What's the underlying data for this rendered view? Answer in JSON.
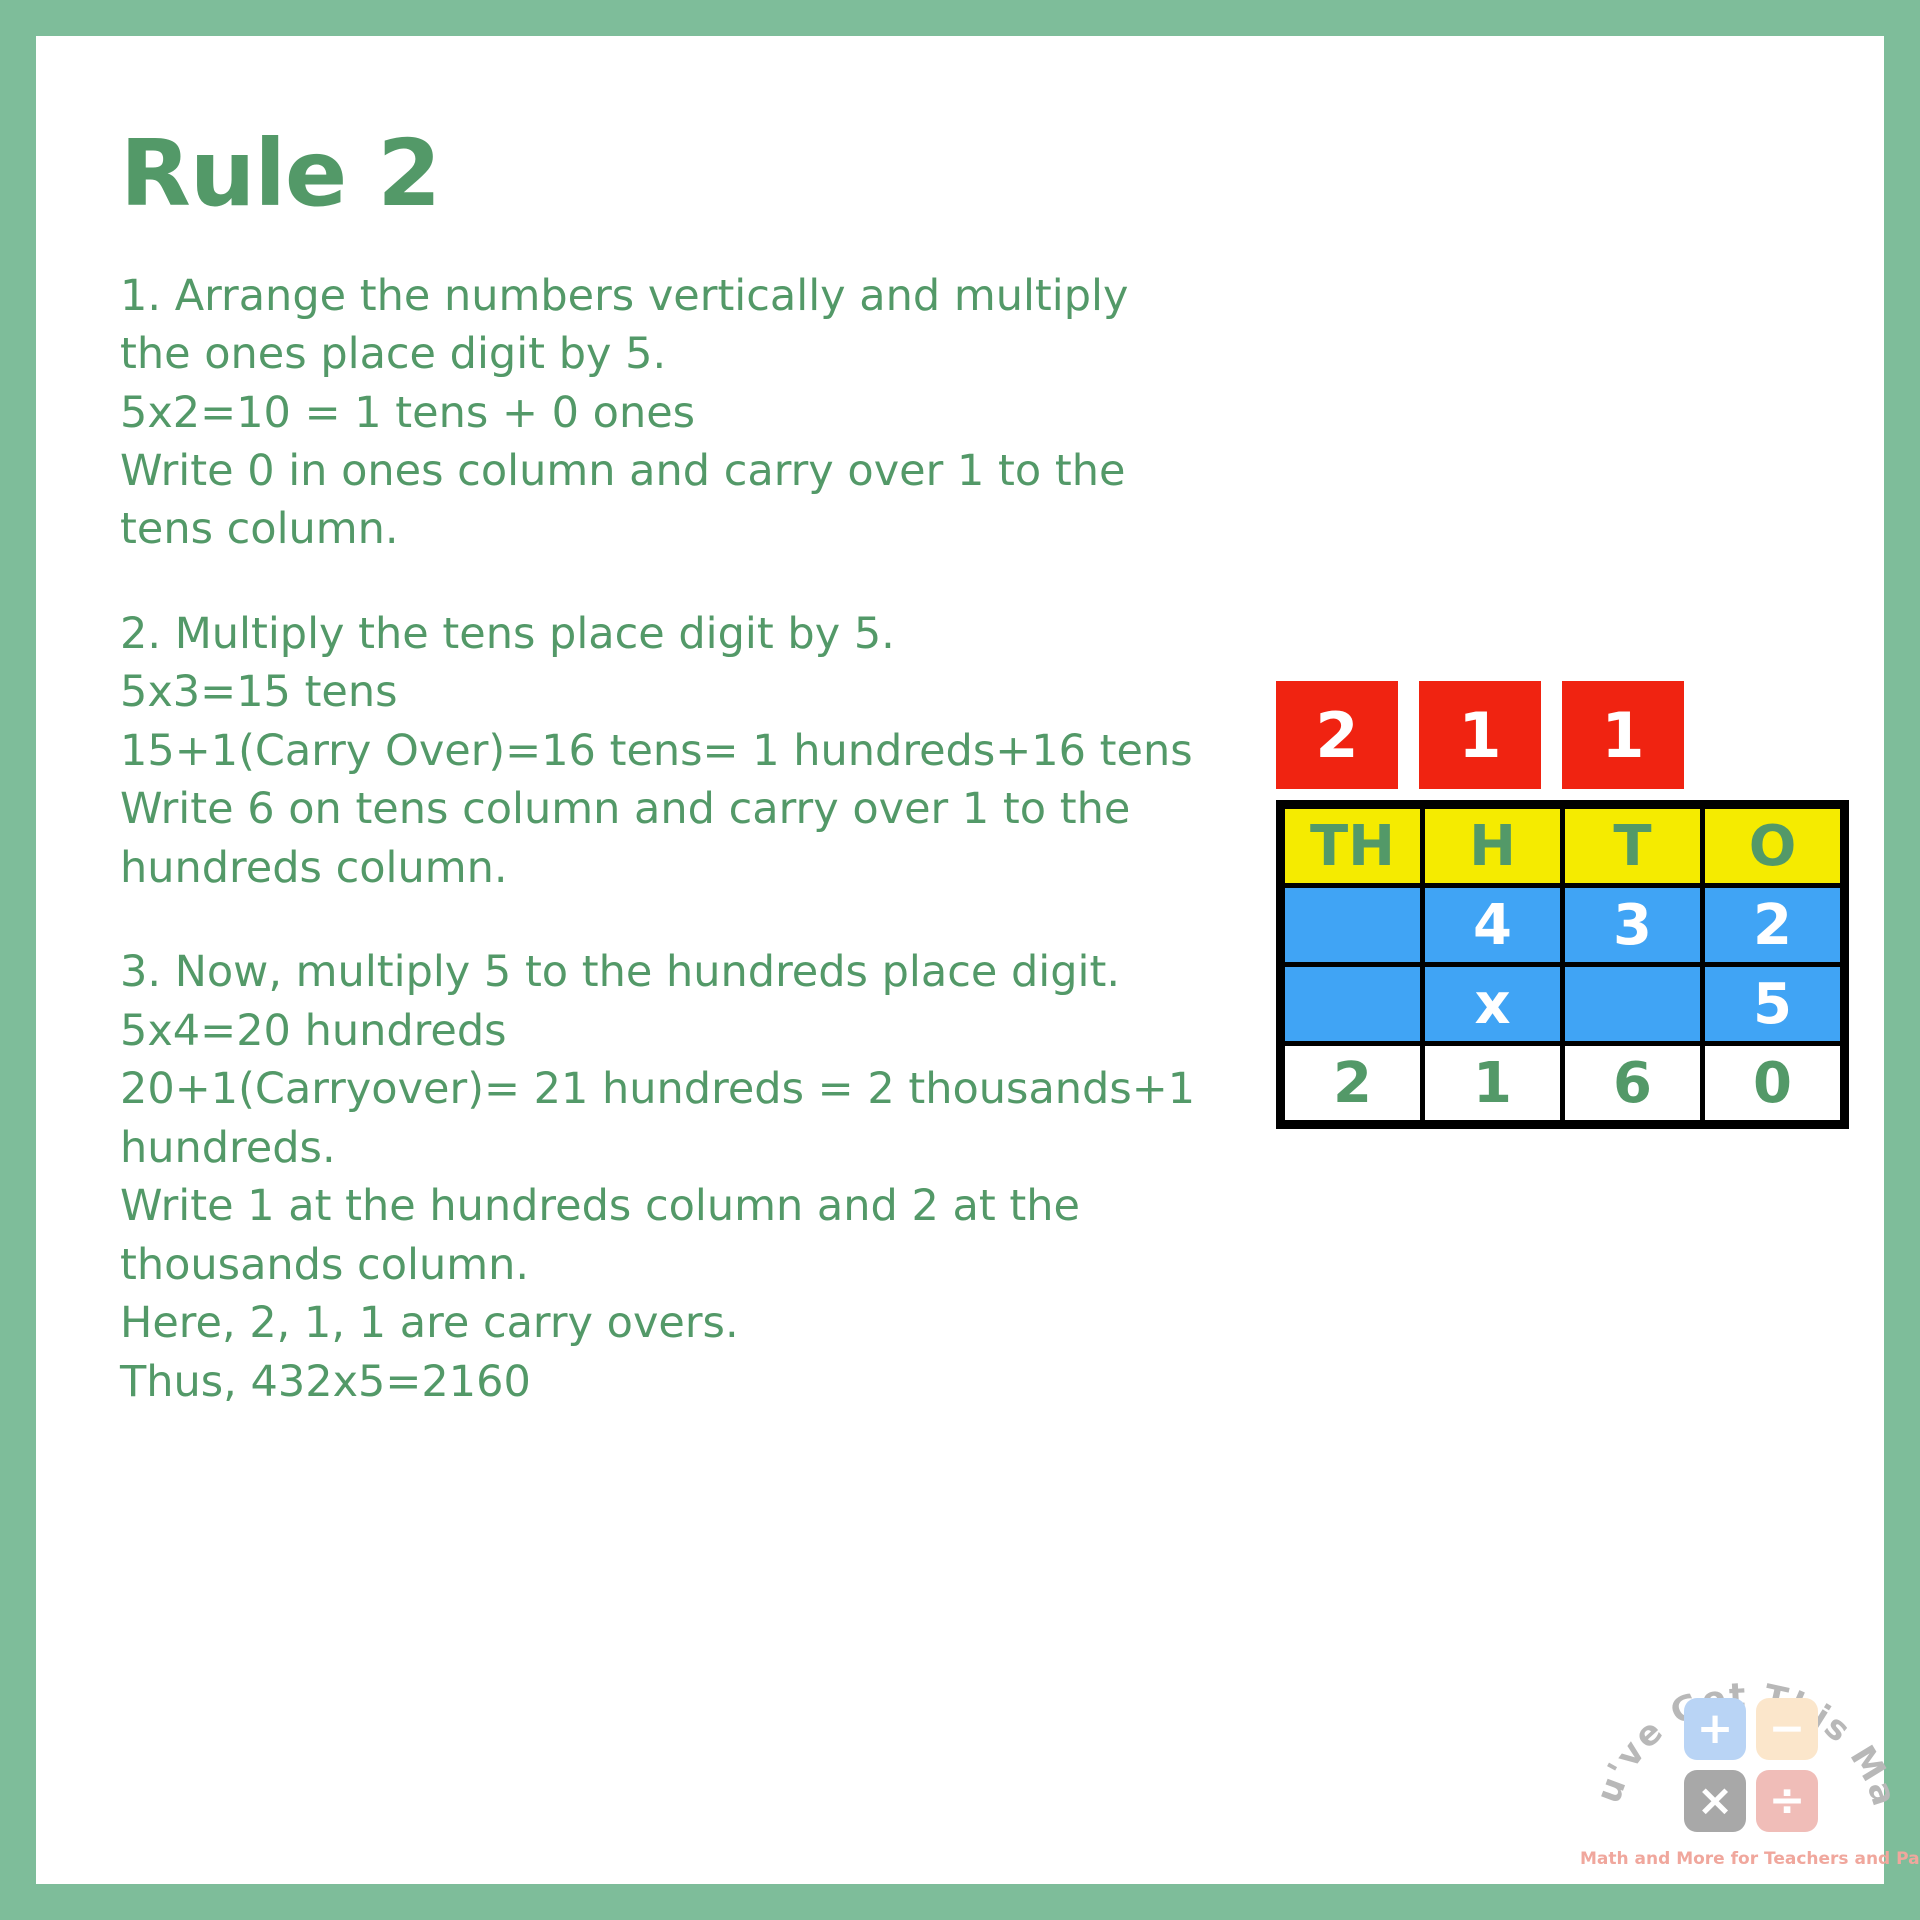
{
  "theme": {
    "border_green": "#7ebd9a",
    "text_green": "#539968",
    "carry_red": "#f02311",
    "header_yellow": "#f5eb00",
    "cell_blue": "#40a4f5",
    "grid_black": "#000000",
    "page_white": "#ffffff"
  },
  "title": "Rule 2",
  "steps": [
    {
      "lines": [
        "1. Arrange the numbers vertically and multiply",
        "the ones place digit by 5.",
        "5x2=10 = 1 tens + 0 ones",
        "Write 0 in ones column and carry over 1 to the",
        "tens column."
      ]
    },
    {
      "lines": [
        "2. Multiply the tens place digit by 5.",
        "5x3=15 tens",
        "15+1(Carry Over)=16 tens= 1 hundreds+16 tens",
        "Write 6 on tens column and carry over 1 to the",
        "hundreds column."
      ]
    },
    {
      "lines": [
        "3. Now, multiply 5 to the hundreds place digit.",
        "5x4=20 hundreds",
        "20+1(Carryover)= 21 hundreds = 2 thousands+1",
        "hundreds.",
        "Write 1 at the hundreds column and 2 at the",
        "thousands column.",
        "Here, 2, 1, 1 are carry overs.",
        "Thus, 432x5=2160"
      ]
    }
  ],
  "place_value_table": {
    "carry_overs": [
      "2",
      "1",
      "1"
    ],
    "headers": [
      "TH",
      "H",
      "T",
      "O"
    ],
    "multiplicand_row": [
      "",
      "4",
      "3",
      "2"
    ],
    "multiplier_row": [
      "",
      "x",
      "",
      "5"
    ],
    "answer_row": [
      "2",
      "1",
      "6",
      "0"
    ]
  },
  "logo": {
    "arc_text": "You've Got This Math",
    "operators": [
      "+",
      "−",
      "×",
      "÷"
    ],
    "tagline": "Math and More for Teachers and Parents"
  }
}
